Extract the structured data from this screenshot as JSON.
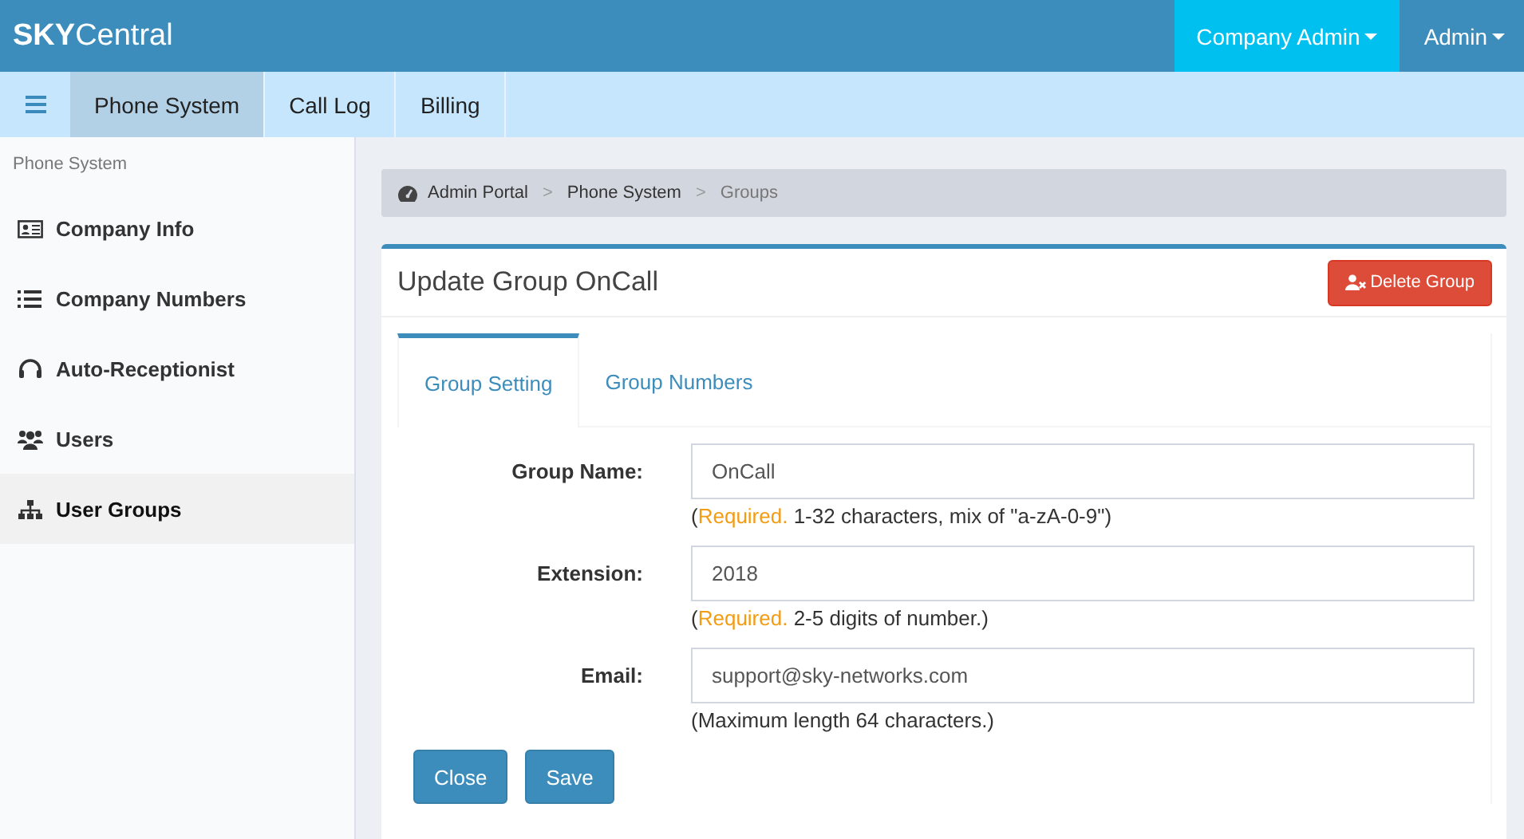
{
  "brand": "**SKY**Central",
  "top_menu": [
    {
      "label": "Company Admin",
      "selected": true
    },
    {
      "label": "Admin",
      "selected": false
    }
  ],
  "nav_tabs": [
    {
      "label": "Phone System",
      "selected": true
    },
    {
      "label": "Call Log",
      "selected": false
    },
    {
      "label": "Billing",
      "selected": false
    }
  ],
  "sidebar": {
    "heading": "Phone System",
    "items": [
      {
        "kind": "card",
        "label": "Company Info",
        "selected": false
      },
      {
        "kind": "list",
        "label": "Company Numbers",
        "selected": false
      },
      {
        "kind": "headset",
        "label": "Auto-Receptionist",
        "selected": false
      },
      {
        "kind": "users",
        "label": "Users",
        "selected": false
      },
      {
        "kind": "sitemap",
        "label": "User Groups",
        "selected": true
      }
    ]
  },
  "breadcrumb": [
    {
      "label": "Admin Portal"
    },
    {
      "separator": ">",
      "label": "Phone System"
    },
    {
      "separator": ">",
      "label": "Groups"
    }
  ],
  "card": {
    "title": "Update Group OnCall",
    "delete_button": "Delete Group",
    "tabs": [
      {
        "label": "Group Setting",
        "selected": true
      },
      {
        "label": "Group Numbers",
        "selected": false
      }
    ],
    "fields": [
      {
        "label": "Group Name:",
        "value": "OnCall",
        "help": [
          {
            "kind": "plain",
            "text": "("
          },
          {
            "kind": "flag",
            "text": "Required."
          },
          {
            "kind": "plain",
            "text": " 1-32 characters, mix of \"a-zA-0-9\")"
          }
        ]
      },
      {
        "label": "Extension:",
        "value": "2018",
        "help": [
          {
            "kind": "plain",
            "text": "("
          },
          {
            "kind": "flag",
            "text": "Required."
          },
          {
            "kind": "plain",
            "text": " 2-5 digits of number.)"
          }
        ]
      },
      {
        "label": "Email:",
        "value": "support@sky-networks.com",
        "help": [
          {
            "kind": "plain",
            "text": "(Maximum length 64 characters.)"
          }
        ]
      }
    ],
    "buttons": [
      "Close",
      "Save"
    ]
  }
}
